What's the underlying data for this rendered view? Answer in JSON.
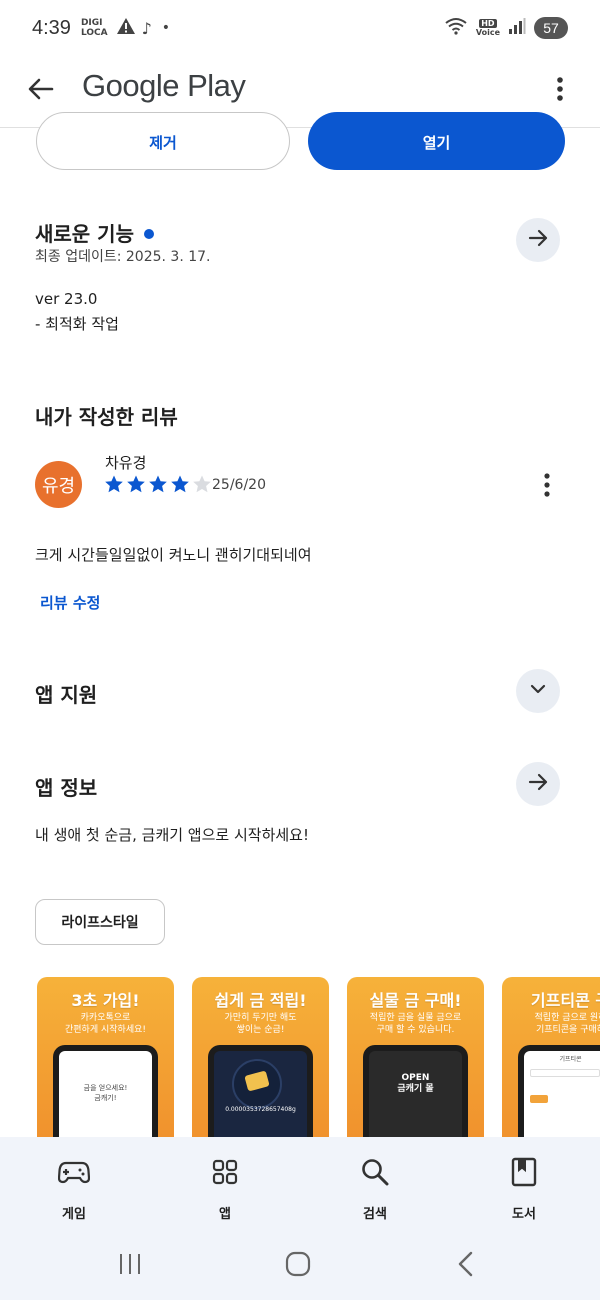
{
  "status_bar": {
    "time": "4:39",
    "carrier_line1": "DIGI",
    "carrier_line2": "LOCA",
    "hd_label": "HD",
    "voice_label": "Voice",
    "battery": "57"
  },
  "app_bar": {
    "title": "Google Play"
  },
  "actions": {
    "remove_label": "제거",
    "open_label": "열기"
  },
  "whats_new": {
    "title": "새로운 기능",
    "last_updated": "최종 업데이트: 2025. 3. 17.",
    "version": "ver 23.0",
    "note": "- 최적화 작업"
  },
  "my_review": {
    "title": "내가 작성한 리뷰",
    "avatar_text": "유경",
    "reviewer_name": "차유경",
    "rating": 4,
    "max_rating": 5,
    "date": "25/6/20",
    "text": "크게 시간들일일없이 켜노니 괜히기대되네여",
    "edit_label": "리뷰 수정"
  },
  "app_support": {
    "title": "앱 지원"
  },
  "about_app": {
    "title": "앱 정보",
    "description": "내 생애 첫 순금, 금캐기 앱으로 시작하세요!",
    "category_chip": "라이프스타일"
  },
  "screenshots": [
    {
      "title": "3초 가입!",
      "subtitle": "카카오톡으로\n간편하게 시작하세요!",
      "screen_text": "금을 얻으세요!\n금캐기!"
    },
    {
      "title": "쉽게 금 적립!",
      "subtitle": "가만히 두기만 해도\n쌓이는 순금!",
      "screen_text": "0.0000353728657408g"
    },
    {
      "title": "실물 금 구매!",
      "subtitle": "적립한 금을 실물 금으로\n구매 할 수 있습니다.",
      "screen_text": "OPEN\n금캐기 몰"
    },
    {
      "title": "기프티콘 구",
      "subtitle": "적립한 금으로 원하\n기프티콘을 구매하",
      "screen_text": "기프티콘"
    }
  ],
  "bottom_nav": {
    "items": [
      {
        "label": "게임",
        "icon": "gamepad-icon"
      },
      {
        "label": "앱",
        "icon": "apps-grid-icon"
      },
      {
        "label": "검색",
        "icon": "search-icon"
      },
      {
        "label": "도서",
        "icon": "book-icon"
      }
    ]
  },
  "colors": {
    "accent": "#0b57d0",
    "avatar": "#e8712d",
    "nav_background": "#f1f4fa"
  }
}
